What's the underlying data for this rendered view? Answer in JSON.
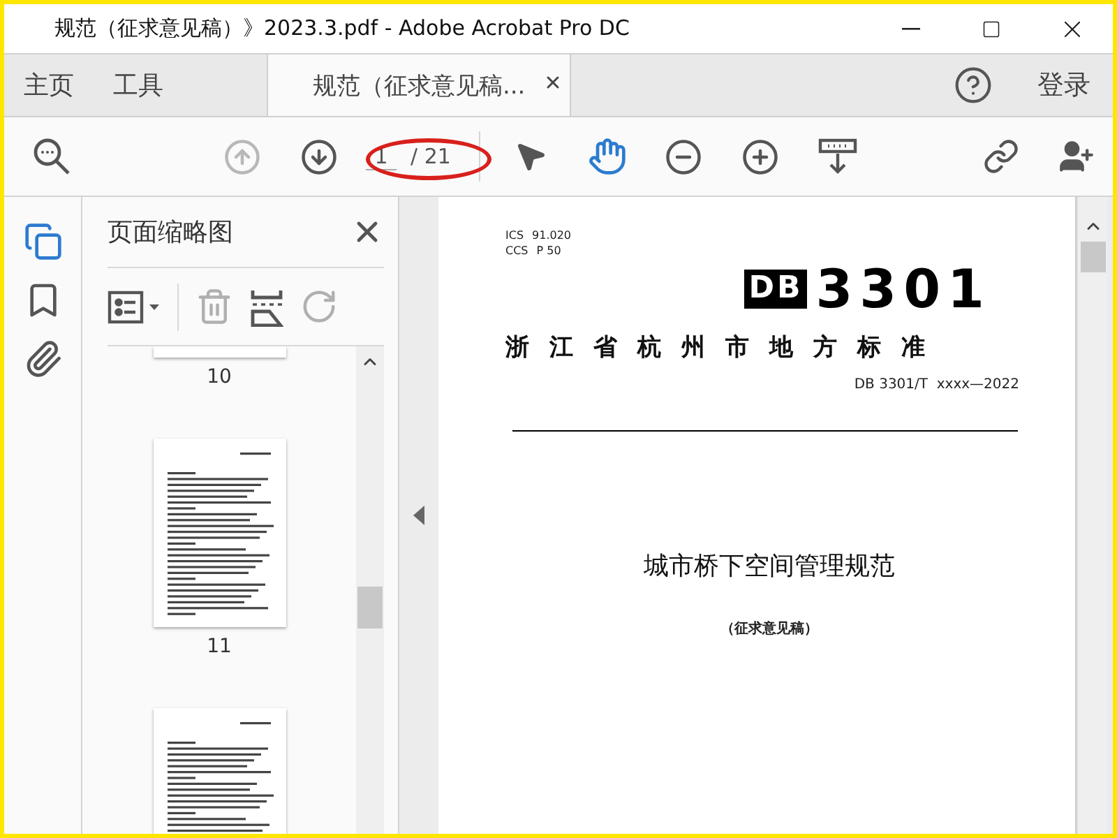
{
  "window": {
    "title": "规范（征求意见稿）》2023.3.pdf - Adobe Acrobat Pro DC"
  },
  "tabs": [
    {
      "label": "主页",
      "selected": false
    },
    {
      "label": "工具",
      "selected": false
    },
    {
      "label": "规范（征求意见稿...",
      "selected": true
    }
  ],
  "header": {
    "sign_in": "登录"
  },
  "toolbar": {
    "left": [
      {
        "kind": "find"
      }
    ],
    "nav": [
      {
        "kind": "prev",
        "disabled": true
      },
      {
        "kind": "next",
        "disabled": false
      }
    ],
    "page": {
      "current": "1",
      "total": "/ 21"
    },
    "tools": [
      {
        "kind": "select",
        "selected": false
      },
      {
        "kind": "hand",
        "selected": true
      },
      {
        "kind": "zoom-out",
        "selected": false
      },
      {
        "kind": "zoom-in",
        "selected": false
      },
      {
        "kind": "keyboard",
        "selected": false
      }
    ],
    "right": [
      {
        "kind": "share-link"
      },
      {
        "kind": "add-user"
      }
    ]
  },
  "rail": [
    {
      "kind": "pages",
      "selected": true
    },
    {
      "kind": "bookmarks",
      "selected": false
    },
    {
      "kind": "attachments",
      "selected": false
    }
  ],
  "thumbnails_panel": {
    "title": "页面缩略图",
    "actions": [
      {
        "kind": "options",
        "disabled": false
      },
      {
        "kind": "delete",
        "disabled": true
      },
      {
        "kind": "insert",
        "disabled": false
      },
      {
        "kind": "rotate",
        "disabled": true
      }
    ],
    "pages": [
      "10",
      "11"
    ]
  },
  "document": {
    "ics_label": "ICS",
    "ics_value": "91.020",
    "ccs_label": "CCS",
    "ccs_value": "P 50",
    "logo_prefix": "DB",
    "logo_number": "3301",
    "issuer": "浙江省杭州市地方标准",
    "code": "DB 3301/T  xxxx—2022",
    "title": "城市桥下空间管理规范",
    "subtitle": "（征求意见稿）"
  }
}
